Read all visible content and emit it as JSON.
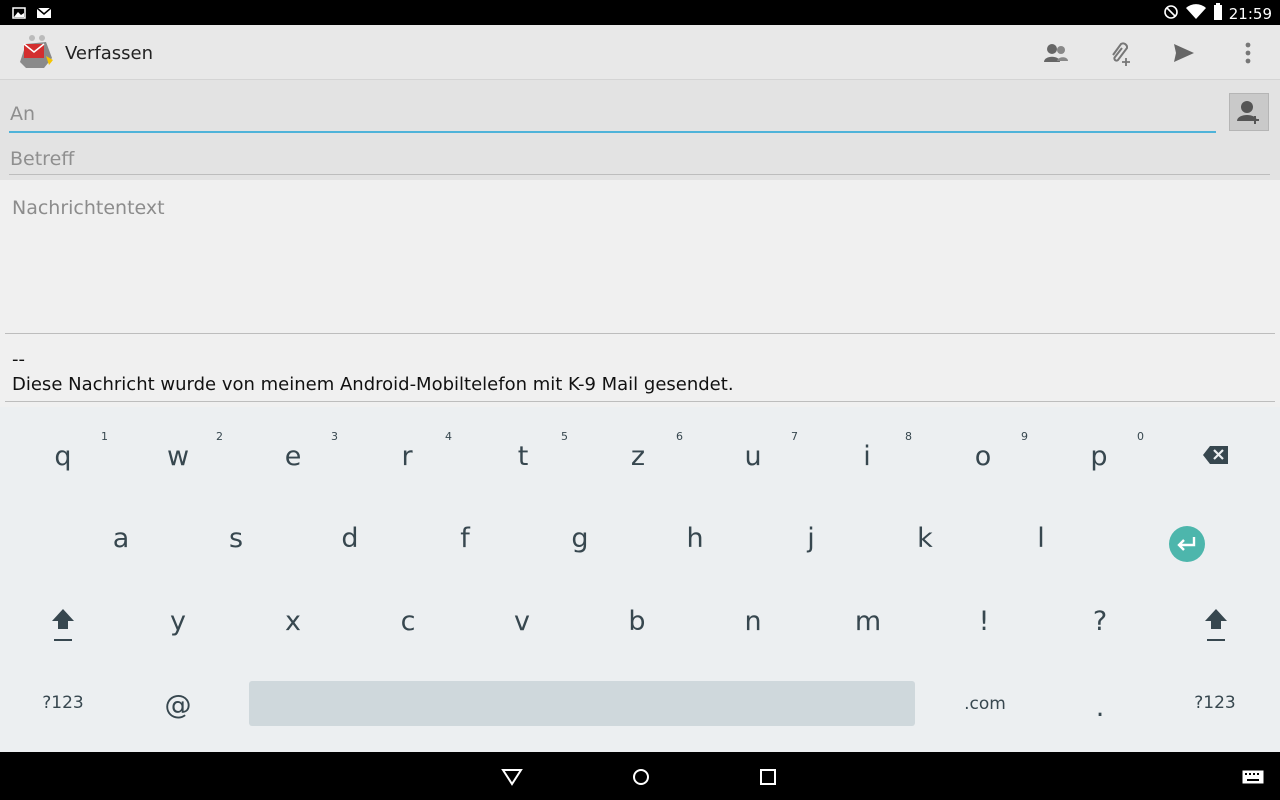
{
  "status_bar": {
    "time": "21:59",
    "left_icons": [
      "image-icon",
      "mail-icon"
    ],
    "right_icons": [
      "do-not-disturb-icon",
      "wifi-icon",
      "battery-icon"
    ]
  },
  "action_bar": {
    "title": "Verfassen",
    "actions": [
      "contacts-icon",
      "attach-icon",
      "send-icon",
      "overflow-menu-icon"
    ]
  },
  "compose": {
    "to_placeholder": "An",
    "subject_placeholder": "Betreff",
    "body_placeholder": "Nachrichtentext",
    "signature_separator": "--",
    "signature_text": "Diese Nachricht wurde von meinem Android-Mobiltelefon mit K-9 Mail gesendet."
  },
  "colors": {
    "focus_underline": "#4fb3d9",
    "enter_key": "#4db6ac",
    "key_text": "#37474f"
  },
  "keyboard": {
    "row1": [
      {
        "key": "q",
        "hint": "1"
      },
      {
        "key": "w",
        "hint": "2"
      },
      {
        "key": "e",
        "hint": "3"
      },
      {
        "key": "r",
        "hint": "4"
      },
      {
        "key": "t",
        "hint": "5"
      },
      {
        "key": "z",
        "hint": "6"
      },
      {
        "key": "u",
        "hint": "7"
      },
      {
        "key": "i",
        "hint": "8"
      },
      {
        "key": "o",
        "hint": "9"
      },
      {
        "key": "p",
        "hint": "0"
      }
    ],
    "row2": [
      "a",
      "s",
      "d",
      "f",
      "g",
      "h",
      "j",
      "k",
      "l"
    ],
    "row3": [
      "y",
      "x",
      "c",
      "v",
      "b",
      "n",
      "m",
      "!",
      "?"
    ],
    "row4": {
      "symbols_left": "?123",
      "at": "@",
      "dotcom": ".com",
      "period": ".",
      "symbols_right": "?123"
    }
  },
  "nav_bar": [
    "back-icon",
    "home-icon",
    "recents-icon",
    "keyboard-icon"
  ]
}
